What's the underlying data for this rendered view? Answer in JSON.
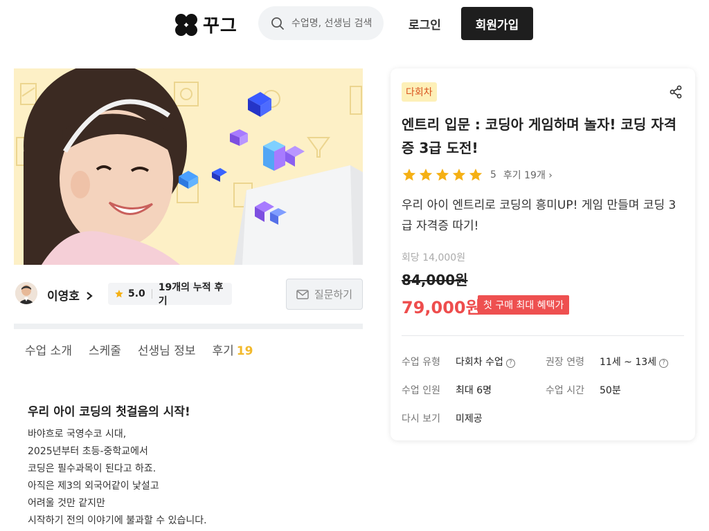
{
  "header": {
    "logo_text": "꾸그",
    "search_placeholder": "수업명, 선생님 검색",
    "login_label": "로그인",
    "signup_label": "회원가입"
  },
  "teacher": {
    "name": "이영호",
    "rating": "5.0",
    "review_summary": "19개의 누적 후기",
    "ask_label": "질문하기"
  },
  "tabs": [
    {
      "label": "수업 소개"
    },
    {
      "label": "스케줄"
    },
    {
      "label": "선생님 정보"
    },
    {
      "label": "후기",
      "count": "19"
    }
  ],
  "intro": {
    "title": "우리 아이 코딩의 첫걸음의 시작!",
    "lines": [
      "바야흐로 국영수코 시대,",
      "2025년부터 초등-중학교에서",
      "코딩은 필수과목이 된다고 하죠.",
      "아직은 제3의 외국어같이 낯설고",
      "어려울 것만 같지만",
      "시작하기 전의 이야기에 불과할 수 있습니다."
    ]
  },
  "course": {
    "badge": "다회차",
    "title": "엔트리 입문 : 코딩아 게임하며 놀자! 코딩 자격증 3급 도전!",
    "star_count": 5,
    "score": "5",
    "review_link": "후기 19개 ›",
    "description": "우리 아이 엔트리로 코딩의 흥미UP! 게임 만들며 코딩 3급 자격증 따기!",
    "per_session_price": "회당 14,000원",
    "original_price": "84,000원",
    "sale_price": "79,000원",
    "promo": "첫 구매 최대 혜택가",
    "info": {
      "type_label": "수업 유형",
      "type_value": "다회차 수업",
      "age_label": "권장 연령",
      "age_value": "11세 ~ 13세",
      "size_label": "수업 인원",
      "size_value": "최대 6명",
      "time_label": "수업 시간",
      "time_value": "50분",
      "replay_label": "다시 보기",
      "replay_value": "미제공"
    }
  },
  "colors": {
    "accent_yellow": "#f2b92c",
    "sale_red": "#ee4d4d",
    "badge_bg": "#fdf0b8",
    "dark_button": "#1e1e1e"
  }
}
